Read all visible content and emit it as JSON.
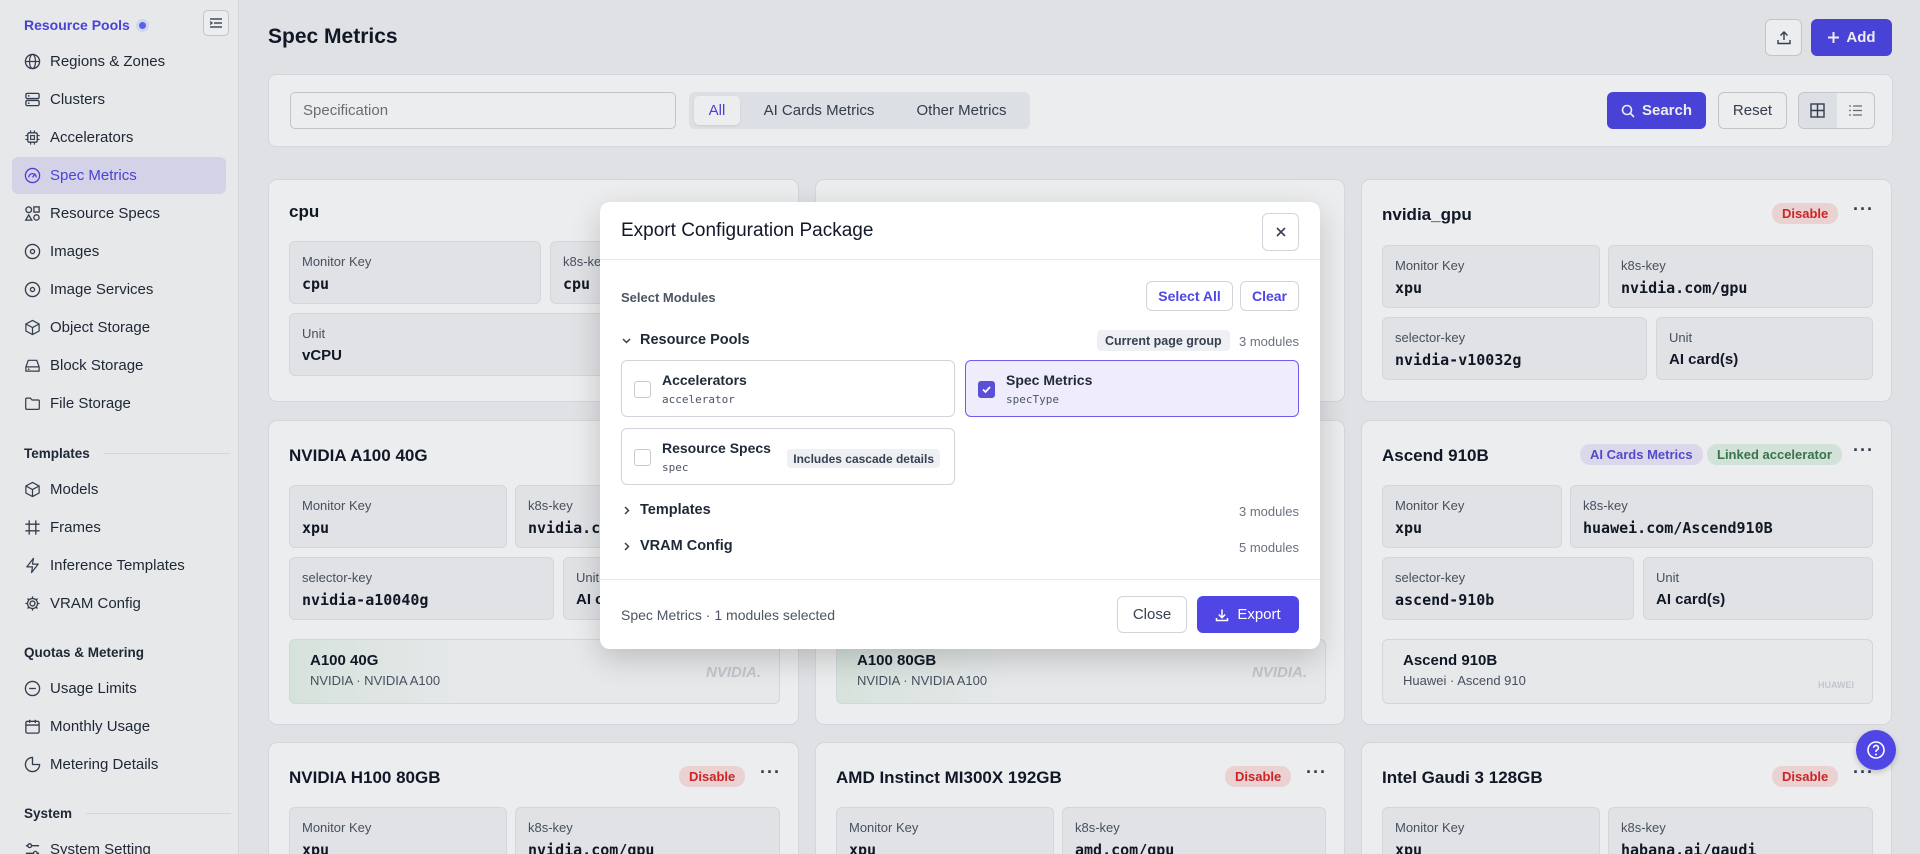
{
  "sidebar": {
    "top_label": "Resource Pools",
    "resource_pools": [
      "Regions & Zones",
      "Clusters",
      "Accelerators",
      "Spec Metrics",
      "Resource Specs",
      "Images",
      "Image Services",
      "Object Storage",
      "Block Storage",
      "File Storage"
    ],
    "templates_heading": "Templates",
    "templates": [
      "Models",
      "Frames",
      "Inference Templates",
      "VRAM Config"
    ],
    "quotas_heading": "Quotas & Metering",
    "quotas": [
      "Usage Limits",
      "Monthly Usage",
      "Metering Details"
    ],
    "system_heading": "System",
    "system": [
      "System Setting"
    ],
    "active_item": "Spec Metrics"
  },
  "header": {
    "title": "Spec Metrics",
    "add_label": "Add"
  },
  "filter": {
    "placeholder": "Specification",
    "tabs": [
      "All",
      "AI Cards Metrics",
      "Other Metrics"
    ],
    "active_tab": "All",
    "search_label": "Search",
    "reset_label": "Reset"
  },
  "cards": {
    "cpu": {
      "title": "cpu",
      "monitor_label": "Monitor Key",
      "monitor_value": "cpu",
      "k8s_label": "k8s-key",
      "k8s_value": "cpu",
      "unit_label": "Unit",
      "unit_value": "vCPU"
    },
    "nvidia_gpu": {
      "title": "nvidia_gpu",
      "badge": "Disable",
      "monitor_label": "Monitor Key",
      "monitor_value": "xpu",
      "k8s_label": "k8s-key",
      "k8s_value": "nvidia.com/gpu",
      "selector_label": "selector-key",
      "selector_value": "nvidia-v10032g",
      "unit_label": "Unit",
      "unit_value": "AI card(s)"
    },
    "a100_40": {
      "title": "NVIDIA A100 40G",
      "monitor_label": "Monitor Key",
      "monitor_value": "xpu",
      "k8s_label": "k8s-key",
      "k8s_value": "nvidia.co",
      "selector_label": "selector-key",
      "selector_value": "nvidia-a10040g",
      "unit_label": "Unit",
      "unit_value": "AI c",
      "brand_name": "A100 40G",
      "brand_sub": "NVIDIA · NVIDIA A100",
      "brand_logo": "NVIDIA."
    },
    "a100_80": {
      "brand_name": "A100 80GB",
      "brand_sub": "NVIDIA · NVIDIA A100",
      "brand_logo": "NVIDIA."
    },
    "ascend": {
      "title": "Ascend 910B",
      "badge1": "AI Cards Metrics",
      "badge2": "Linked accelerator",
      "monitor_label": "Monitor Key",
      "monitor_value": "xpu",
      "k8s_label": "k8s-key",
      "k8s_value": "huawei.com/Ascend910B",
      "selector_label": "selector-key",
      "selector_value": "ascend-910b",
      "unit_label": "Unit",
      "unit_value": "AI card(s)",
      "brand_name": "Ascend 910B",
      "brand_sub": "Huawei · Ascend 910",
      "brand_logo": "HUAWEI"
    },
    "h100": {
      "title": "NVIDIA H100 80GB",
      "badge": "Disable",
      "monitor_label": "Monitor Key",
      "monitor_value": "xpu",
      "k8s_label": "k8s-key",
      "k8s_value": "nvidia.com/gpu"
    },
    "mi300x": {
      "title": "AMD Instinct MI300X 192GB",
      "badge": "Disable",
      "monitor_label": "Monitor Key",
      "monitor_value": "xpu",
      "k8s_label": "k8s-key",
      "k8s_value": "amd.com/gpu"
    },
    "gaudi": {
      "title": "Intel Gaudi 3 128GB",
      "badge": "Disable",
      "monitor_label": "Monitor Key",
      "monitor_value": "xpu",
      "k8s_label": "k8s-key",
      "k8s_value": "habana.ai/gaudi"
    }
  },
  "modal": {
    "title": "Export Configuration Package",
    "select_modules_label": "Select Modules",
    "select_all_label": "Select All",
    "clear_label": "Clear",
    "group_resource_pools": "Resource Pools",
    "current_page_tag": "Current page group",
    "group_resource_pools_count": "3 modules",
    "modules": [
      {
        "name": "Accelerators",
        "key": "accelerator",
        "checked": false
      },
      {
        "name": "Spec Metrics",
        "key": "specType",
        "checked": true
      },
      {
        "name": "Resource Specs",
        "key": "spec",
        "checked": false,
        "tag": "Includes cascade details"
      }
    ],
    "group_templates": "Templates",
    "group_templates_count": "3 modules",
    "group_vram": "VRAM Config",
    "group_vram_count": "5 modules",
    "status": "Spec Metrics · 1 modules selected",
    "close_label": "Close",
    "export_label": "Export"
  },
  "colors": {
    "accent": "#4f46e5",
    "disable_badge": "#dc2626",
    "linked_badge": "#3d7b4f"
  }
}
